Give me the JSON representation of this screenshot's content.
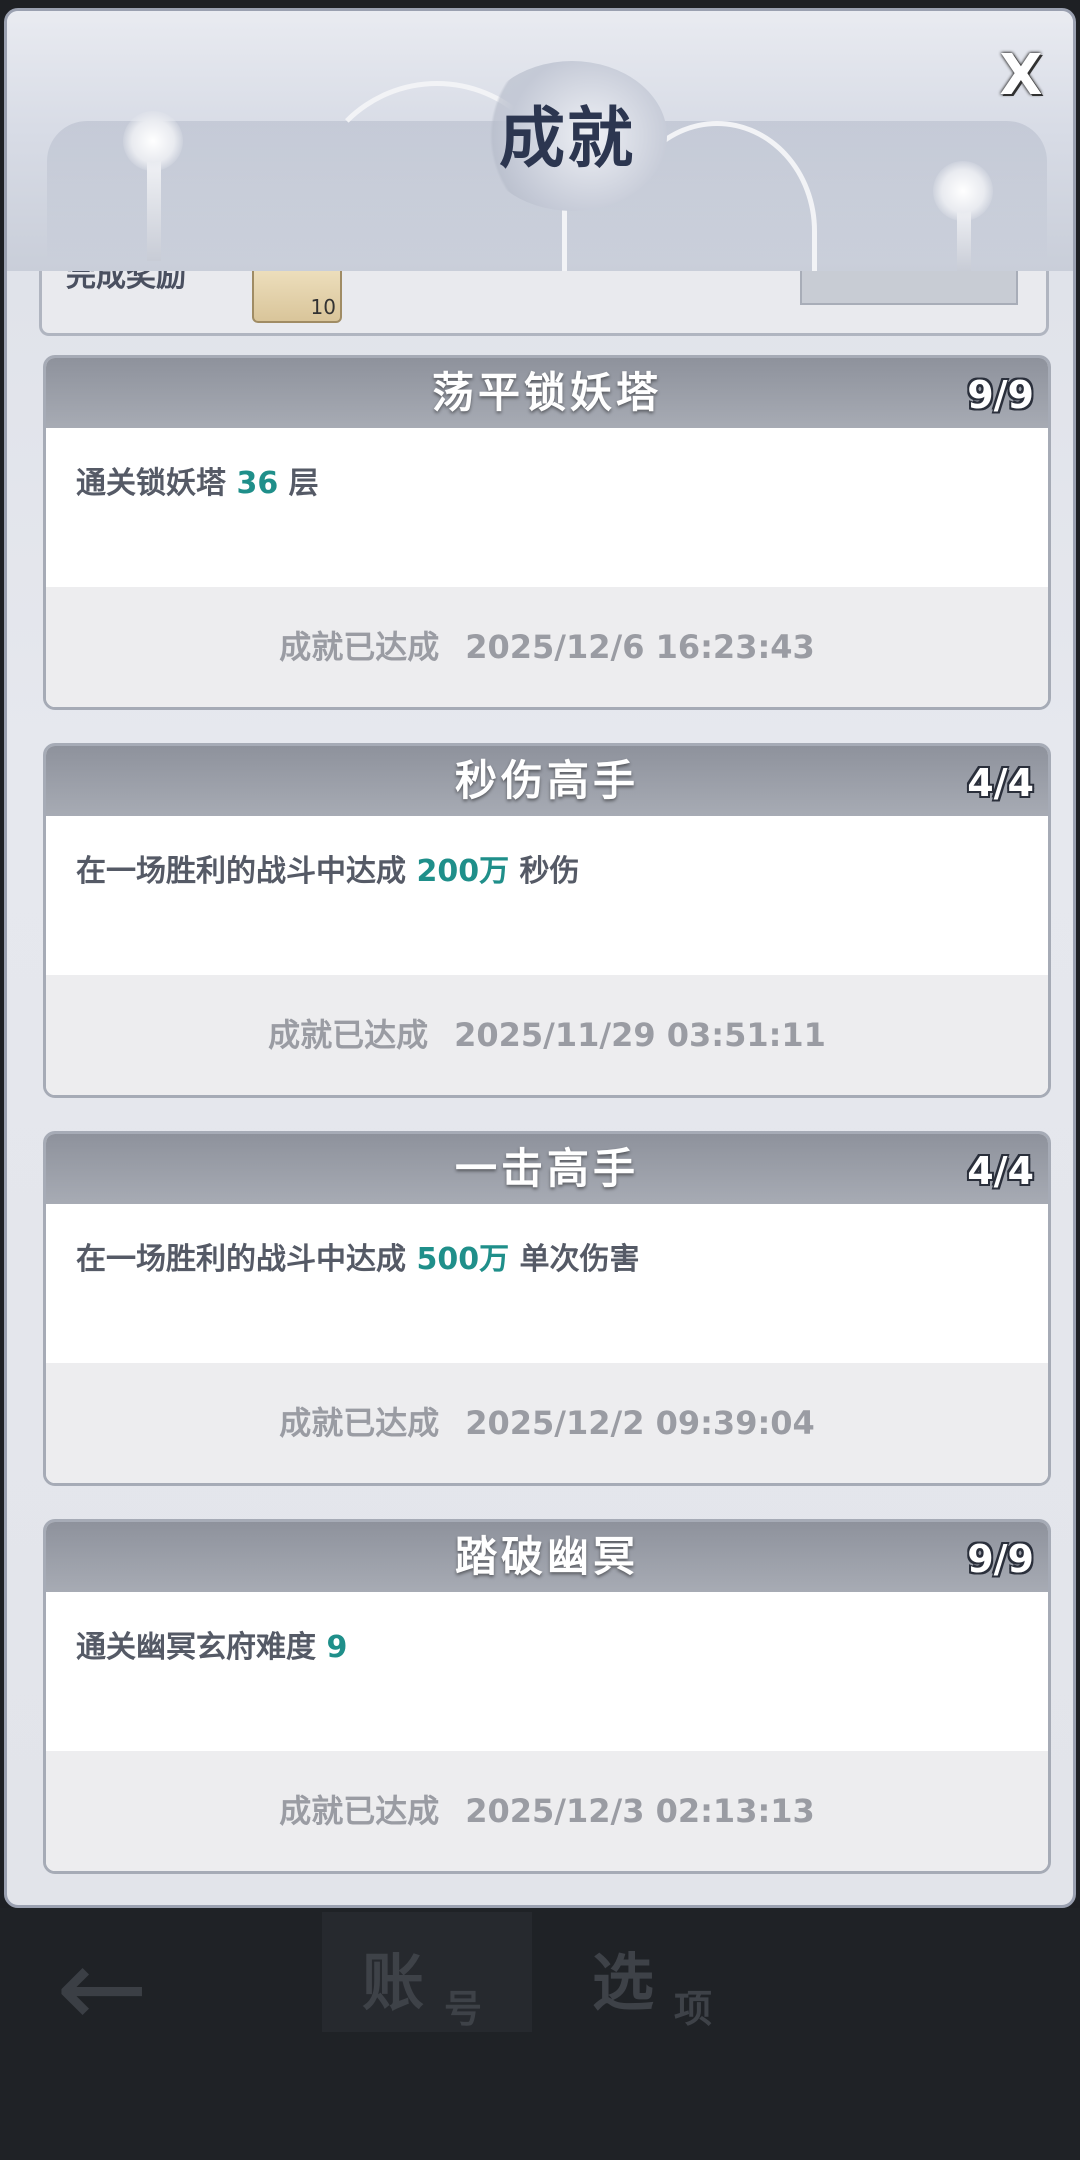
{
  "window": {
    "title": "成就",
    "close_label": "X"
  },
  "partial_card": {
    "label": "完成奖励",
    "item_count": "10"
  },
  "achievements": [
    {
      "title": "荡平锁妖塔",
      "progress": "9/9",
      "desc_prefix": "通关锁妖塔 ",
      "desc_value": "36",
      "desc_suffix": " 层",
      "status": "成就已达成",
      "time": "2025/12/6 16:23:43"
    },
    {
      "title": "秒伤高手",
      "progress": "4/4",
      "desc_prefix": "在一场胜利的战斗中达成 ",
      "desc_value": "200万",
      "desc_suffix": " 秒伤",
      "status": "成就已达成",
      "time": "2025/11/29 03:51:11"
    },
    {
      "title": "一击高手",
      "progress": "4/4",
      "desc_prefix": "在一场胜利的战斗中达成 ",
      "desc_value": "500万",
      "desc_suffix": " 单次伤害",
      "status": "成就已达成",
      "time": "2025/12/2 09:39:04"
    },
    {
      "title": "踏破幽冥",
      "progress": "9/9",
      "desc_prefix": "通关幽冥玄府难度 ",
      "desc_value": "9",
      "desc_suffix": "",
      "status": "成就已达成",
      "time": "2025/12/3 02:13:13"
    }
  ],
  "bottom_nav": {
    "back_icon": "arrow-left-icon",
    "tabs": [
      {
        "big": "账",
        "small": "号"
      },
      {
        "big": "选",
        "small": "项"
      }
    ]
  },
  "colors": {
    "highlight": "#1f8f8a",
    "header_bar": "#9a9ea8",
    "title": "#2c3650"
  }
}
